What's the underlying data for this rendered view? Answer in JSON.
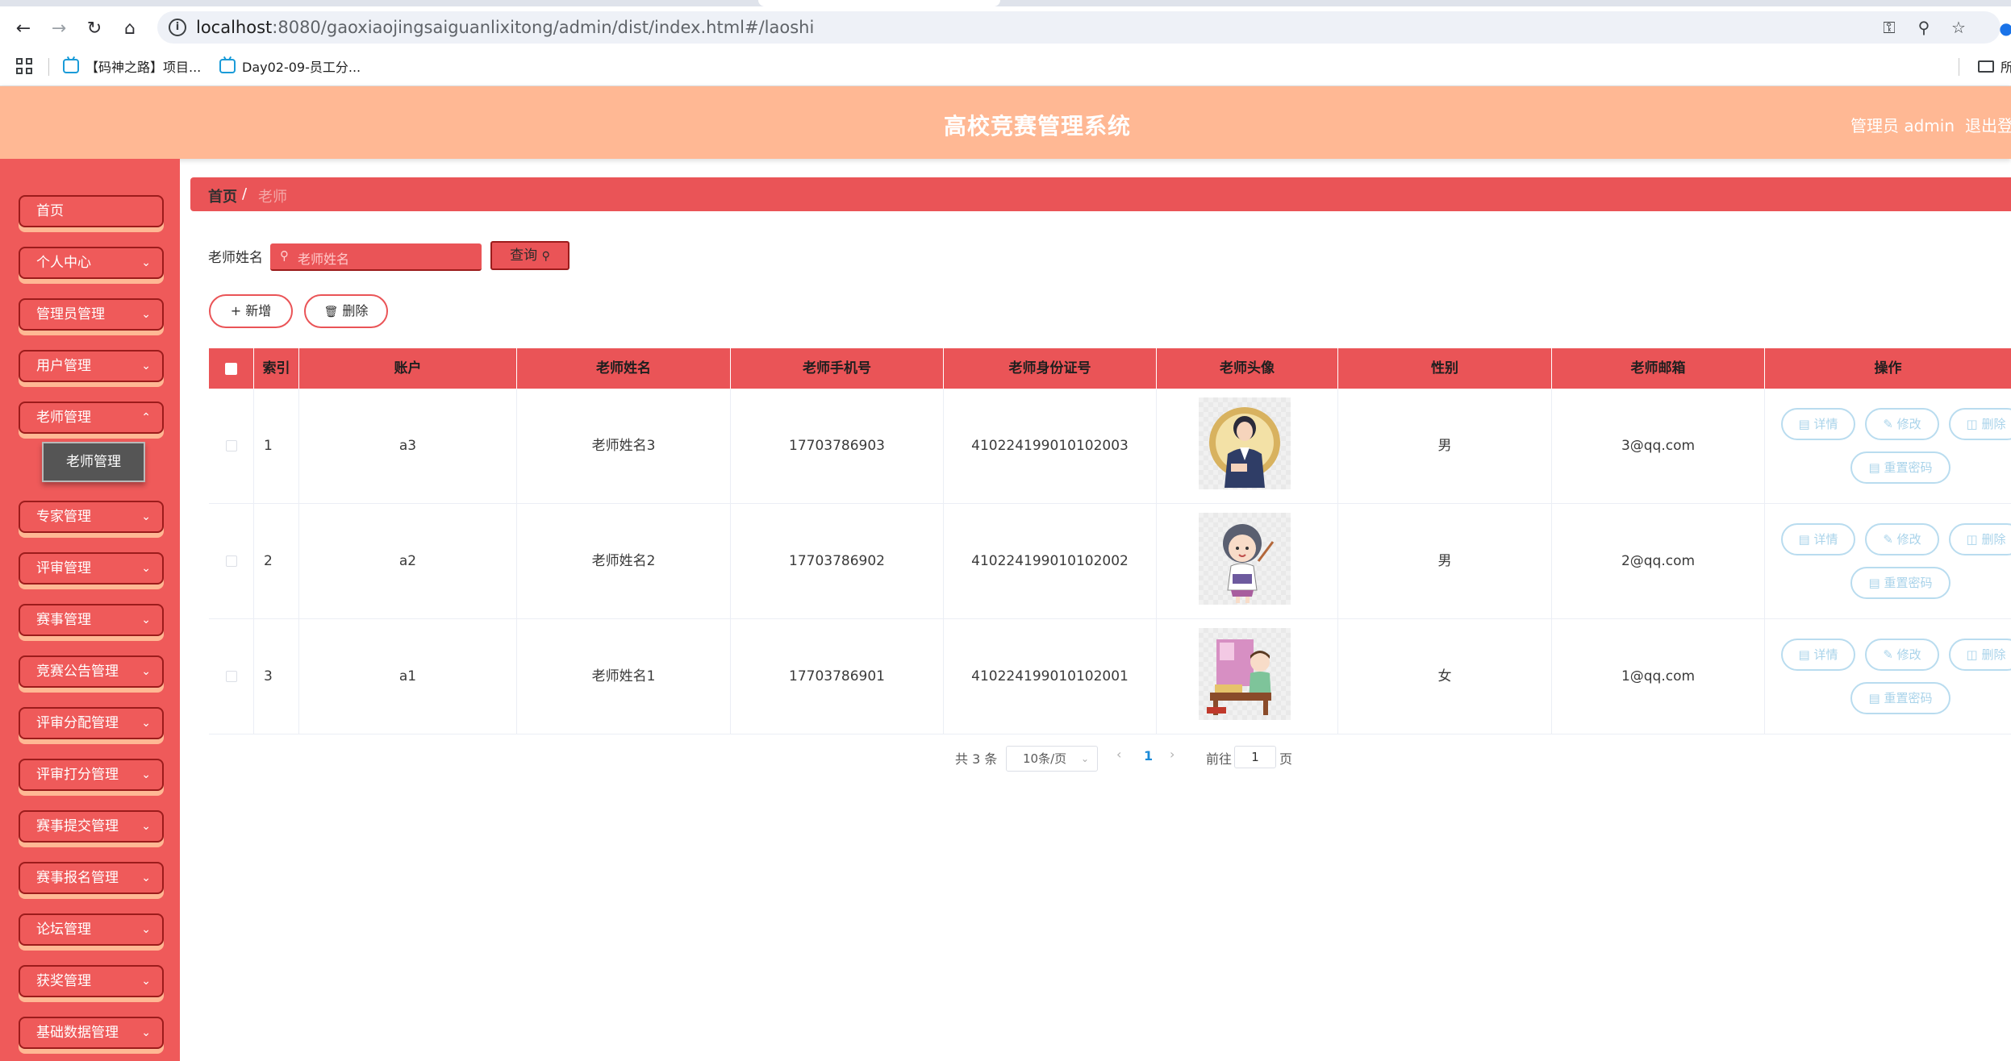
{
  "browser": {
    "url_host": "localhost",
    "url_rest": ":8080/gaoxiaojingsaiguanlixitong/admin/dist/index.html#/laoshi",
    "bookmarks": [
      "【码神之路】项目...",
      "Day02-09-员工分..."
    ],
    "bookmark_folder_label": "所"
  },
  "header": {
    "title": "高校竞赛管理系统",
    "admin_label": "管理员 admin",
    "logout_label": "退出登录"
  },
  "sidebar": {
    "items": [
      {
        "label": "首页",
        "has_children": false
      },
      {
        "label": "个人中心",
        "has_children": true
      },
      {
        "label": "管理员管理",
        "has_children": true
      },
      {
        "label": "用户管理",
        "has_children": true
      },
      {
        "label": "老师管理",
        "has_children": true
      },
      {
        "label": "专家管理",
        "has_children": true
      },
      {
        "label": "评审管理",
        "has_children": true
      },
      {
        "label": "赛事管理",
        "has_children": true
      },
      {
        "label": "竞赛公告管理",
        "has_children": true
      },
      {
        "label": "评审分配管理",
        "has_children": true
      },
      {
        "label": "评审打分管理",
        "has_children": true
      },
      {
        "label": "赛事提交管理",
        "has_children": true
      },
      {
        "label": "赛事报名管理",
        "has_children": true
      },
      {
        "label": "论坛管理",
        "has_children": true
      },
      {
        "label": "获奖管理",
        "has_children": true
      },
      {
        "label": "基础数据管理",
        "has_children": true
      }
    ],
    "open_submenu_label": "老师管理"
  },
  "breadcrumb": {
    "home": "首页",
    "separator": "/",
    "current": "老师"
  },
  "search": {
    "label": "老师姓名",
    "placeholder": "老师姓名",
    "query_button": "查询"
  },
  "actions": {
    "add_label": "新增",
    "delete_label": "删除"
  },
  "table": {
    "headers": [
      "索引",
      "账户",
      "老师姓名",
      "老师手机号",
      "老师身份证号",
      "老师头像",
      "性别",
      "老师邮箱",
      "操作"
    ],
    "rows": [
      {
        "index": "1",
        "account": "a3",
        "name": "老师姓名3",
        "phone": "17703786903",
        "id_card": "410224199010102003",
        "avatar": "teacher-in-suit-avatar",
        "gender": "男",
        "email": "3@qq.com"
      },
      {
        "index": "2",
        "account": "a2",
        "name": "老师姓名2",
        "phone": "17703786902",
        "id_card": "410224199010102002",
        "avatar": "teacher-with-pointer-avatar",
        "gender": "男",
        "email": "2@qq.com"
      },
      {
        "index": "3",
        "account": "a1",
        "name": "老师姓名1",
        "phone": "17703786901",
        "id_card": "410224199010102001",
        "avatar": "teacher-at-desk-avatar",
        "gender": "女",
        "email": "1@qq.com"
      }
    ],
    "row_actions": {
      "detail": "详情",
      "edit": "修改",
      "delete": "删除",
      "reset_password": "重置密码"
    }
  },
  "pagination": {
    "total_text": "共 3 条",
    "page_size": "10条/页",
    "current_page": "1",
    "goto_prefix": "前往",
    "goto_value": "1",
    "goto_suffix": "页"
  },
  "colors": {
    "header_bg": "#ffb894",
    "sidebar_bg": "#ef5a5a",
    "accent": "#ea5457",
    "action_outline": "#b9dcef"
  }
}
